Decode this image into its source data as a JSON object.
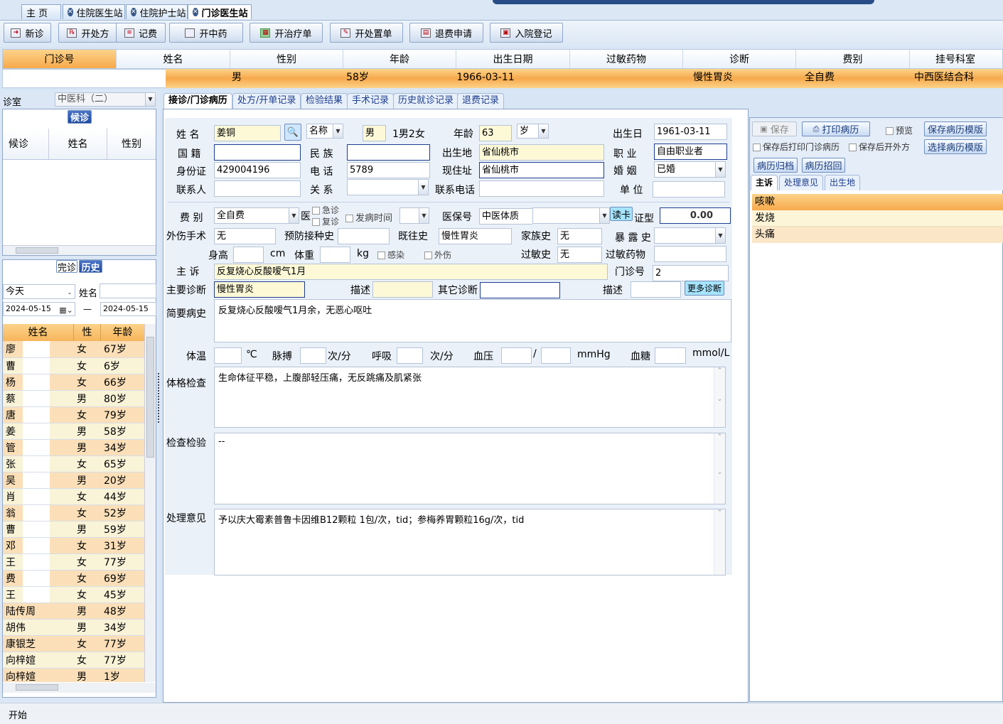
{
  "tabs": [
    {
      "label": "主  页",
      "active": false
    },
    {
      "label": "住院医生站",
      "active": false
    },
    {
      "label": "住院护士站",
      "active": false
    },
    {
      "label": "门诊医生站",
      "active": true
    }
  ],
  "toolbar": [
    "新诊",
    "开处方",
    "记费",
    "开中药",
    "开治疗单",
    "开处置单",
    "退费申请",
    "入院登记"
  ],
  "patient_header": {
    "columns": [
      "门诊号",
      "姓名",
      "性别",
      "年龄",
      "出生日期",
      "过敏药物",
      "诊断",
      "费别",
      "挂号科室"
    ],
    "values": {
      "gender": "男",
      "age": "58岁",
      "birth": "1966-03-11",
      "diagnosis": "慢性胃炎",
      "fee": "全自费",
      "dept": "中西医结合科"
    }
  },
  "left": {
    "clinic_label": "诊室",
    "clinic_value": "中医科（二）",
    "waiting_btn": "候诊",
    "waiting_cols": [
      "候诊",
      "姓名",
      "性别"
    ],
    "tab_done": "完诊",
    "tab_history": "历史",
    "date_range": "今天",
    "name_label": "姓名",
    "date_from": "2024-05-15",
    "date_sep": "—",
    "date_to": "2024-05-15",
    "list_cols": [
      "姓名",
      "性",
      "年龄"
    ],
    "patients": [
      [
        "廖",
        "女",
        "67岁"
      ],
      [
        "曹",
        "女",
        "6岁"
      ],
      [
        "杨",
        "女",
        "66岁"
      ],
      [
        "蔡",
        "男",
        "80岁"
      ],
      [
        "唐",
        "女",
        "79岁"
      ],
      [
        "姜",
        "男",
        "58岁"
      ],
      [
        "管",
        "男",
        "34岁"
      ],
      [
        "张",
        "女",
        "65岁"
      ],
      [
        "吴",
        "男",
        "20岁"
      ],
      [
        "肖",
        "女",
        "44岁"
      ],
      [
        "翁",
        "女",
        "52岁"
      ],
      [
        "曹",
        "男",
        "59岁"
      ],
      [
        "邓",
        "女",
        "31岁"
      ],
      [
        "王",
        "女",
        "77岁"
      ],
      [
        "费",
        "女",
        "69岁"
      ],
      [
        "王",
        "女",
        "45岁"
      ],
      [
        "陆传周",
        "男",
        "48岁"
      ],
      [
        "胡伟",
        "男",
        "34岁"
      ],
      [
        "康银芝",
        "女",
        "77岁"
      ],
      [
        "向梓媗",
        "女",
        "77岁"
      ],
      [
        "向梓媗",
        "男",
        "1岁"
      ]
    ]
  },
  "subtabs": [
    "接诊/门诊病历",
    "处方/开单记录",
    "检验结果",
    "手术记录",
    "历史就诊记录",
    "退费记录"
  ],
  "form": {
    "name_label": "姓  名",
    "name": "姜铜",
    "name_type": "名称",
    "gender": "男",
    "gender_hint": "1男2女",
    "age_label": "年龄",
    "age": "63",
    "age_unit": "岁",
    "birth_label": "出生日",
    "birth": "1961-03-11",
    "nation_label": "国  籍",
    "ethnic_label": "民  族",
    "birthplace_label": "出生地",
    "birthplace": "省仙桃市",
    "job_label": "职  业",
    "job": "自由职业者",
    "id_label": "身份证",
    "id": "429004196",
    "phone_label": "电  话",
    "phone": "5789",
    "addr_label": "现住址",
    "addr": "省仙桃市",
    "marry_label": "婚  姻",
    "marry": "已婚",
    "contact_label": "联系人",
    "rel_label": "关  系",
    "cphone_label": "联系电话",
    "unit_label": "单  位",
    "fee_label": "费  别",
    "fee": "全自费",
    "yi": "医",
    "urgent": "急诊",
    "revisit": "复诊",
    "onset": "发病时间",
    "insno_label": "医保号",
    "tcm_label": "中医体质",
    "readcard": "读卡",
    "cert_label": "证型",
    "amount": "0.00",
    "trauma_label": "外伤手术",
    "trauma": "无",
    "vacc_label": "预防接种史",
    "past_label": "既往史",
    "past": "慢性胃炎",
    "family_label": "家族史",
    "family": "无",
    "expose_label": "暴 露 史",
    "height_label": "身高",
    "cm": "cm",
    "weight_label": "体重",
    "kg": "kg",
    "infect": "感染",
    "injury": "外伤",
    "allergy_hist_label": "过敏史",
    "allergy_hist": "无",
    "allergy_drug_label": "过敏药物",
    "complaint_label": "主  诉",
    "complaint": "反复烧心反酸嗳气1月",
    "visitno_label": "门诊号",
    "visitno": "2",
    "maindiag_label": "主要诊断",
    "maindiag": "慢性胃炎",
    "desc_label": "描述",
    "otherdiag_label": "其它诊断",
    "desc2_label": "描述",
    "morediag": "更多诊断",
    "brief_label": "简要病史",
    "brief": "反复烧心反酸嗳气1月余，无恶心呕吐",
    "temp_label": "体温",
    "temp_unit": "℃",
    "pulse_label": "脉搏",
    "pulse_unit": "次/分",
    "resp_label": "呼吸",
    "resp_unit": "次/分",
    "bp_label": "血压",
    "bp_sep": "/",
    "bp_unit": "mmHg",
    "glu_label": "血糖",
    "glu_unit": "mmol/L",
    "exam_label": "体格检查",
    "exam": "生命体征平稳，上腹部轻压痛，无反跳痛及肌紧张",
    "lab_label": "检查检验",
    "lab": "--",
    "plan_label": "处理意见",
    "plan": "予以庆大霉素普鲁卡因维B12颗粒 1包/次，tid；参梅养胃颗粒16g/次，tid"
  },
  "right": {
    "save": "保存",
    "print": "打印病历",
    "preview": "预览",
    "save_tpl": "保存病历模版",
    "print_after": "保存后打印门诊病历",
    "rx_after": "保存后开外方",
    "select_tpl": "选择病历模版",
    "archive": "病历归档",
    "recall": "病历招回",
    "tabs": [
      "主诉",
      "处理意见",
      "出生地"
    ],
    "complaints": [
      "咳嗽",
      "发烧",
      "头痛"
    ]
  },
  "status": "开始"
}
